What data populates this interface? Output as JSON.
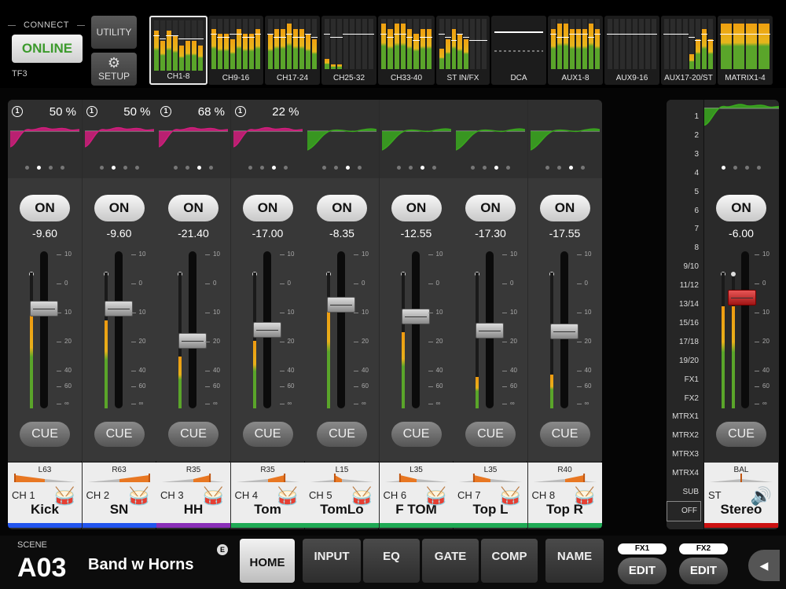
{
  "connect": {
    "title": "CONNECT",
    "status": "ONLINE",
    "device": "TF3"
  },
  "utility_label": "UTILITY",
  "setup_label": "SETUP",
  "banks": [
    {
      "label": "CH1-8",
      "selected": true
    },
    {
      "label": "CH9-16"
    },
    {
      "label": "CH17-24"
    },
    {
      "label": "CH25-32"
    },
    {
      "label": "CH33-40"
    },
    {
      "label": "ST IN/FX"
    },
    {
      "label": "DCA"
    },
    {
      "label": "AUX1-8"
    },
    {
      "label": "AUX9-16"
    },
    {
      "label": "AUX17-20/ST"
    },
    {
      "label": "MATRIX1-4"
    }
  ],
  "channels": [
    {
      "num": "1",
      "pct": "50 %",
      "on": "ON",
      "level": "-9.60",
      "cue": "CUE",
      "pan": "L63",
      "pan_value": -63,
      "id": "CH 1",
      "name": "Kick",
      "color": "#2255ee",
      "eq_color": "#d11d7d",
      "fader_db": -9.6,
      "meter": 0.69,
      "page": 1
    },
    {
      "num": "1",
      "pct": "50 %",
      "on": "ON",
      "level": "-9.60",
      "cue": "CUE",
      "pan": "R63",
      "pan_value": 63,
      "id": "CH 2",
      "name": "SN",
      "color": "#2255ee",
      "eq_color": "#d11d7d",
      "fader_db": -9.6,
      "meter": 0.65,
      "page": 1
    },
    {
      "num": "1",
      "pct": "68 %",
      "on": "ON",
      "level": "-21.40",
      "cue": "CUE",
      "pan": "R35",
      "pan_value": 35,
      "id": "CH 3",
      "name": "HH",
      "color": "#8a2fb8",
      "eq_color": "#d11d7d",
      "fader_db": -21.4,
      "meter": 0.38,
      "page": 2
    },
    {
      "num": "1",
      "pct": "22 %",
      "on": "ON",
      "level": "-17.00",
      "cue": "CUE",
      "pan": "R35",
      "pan_value": 35,
      "id": "CH 4",
      "name": "Tom",
      "color": "#1faa55",
      "eq_color": "#d11d7d",
      "fader_db": -17.0,
      "meter": 0.5,
      "page": 2
    },
    {
      "num": "",
      "pct": "",
      "on": "ON",
      "level": "-8.35",
      "cue": "CUE",
      "pan": "L15",
      "pan_value": -15,
      "id": "CH 5",
      "name": "TomLo",
      "color": "#1faa55",
      "eq_color": "#3aa81e",
      "fader_db": -8.35,
      "meter": 0.76,
      "page": 2
    },
    {
      "num": "",
      "pct": "",
      "on": "ON",
      "level": "-12.55",
      "cue": "CUE",
      "pan": "L35",
      "pan_value": -35,
      "id": "CH 6",
      "name": "F TOM",
      "color": "#1faa55",
      "eq_color": "#3aa81e",
      "fader_db": -12.55,
      "meter": 0.56,
      "page": 2
    },
    {
      "num": "",
      "pct": "",
      "on": "ON",
      "level": "-17.30",
      "cue": "CUE",
      "pan": "L35",
      "pan_value": -35,
      "id": "CH 7",
      "name": "Top L",
      "color": "#1faa55",
      "eq_color": "#3aa81e",
      "fader_db": -17.3,
      "meter": 0.23,
      "page": 2
    },
    {
      "num": "",
      "pct": "",
      "on": "ON",
      "level": "-17.55",
      "cue": "CUE",
      "pan": "R40",
      "pan_value": 40,
      "id": "CH 8",
      "name": "Top R",
      "color": "#1faa55",
      "eq_color": "#3aa81e",
      "fader_db": -17.55,
      "meter": 0.25,
      "page": 2
    }
  ],
  "scale_marks": [
    "10",
    "0",
    "10",
    "20",
    "40",
    "60",
    "∞"
  ],
  "dca_labels": [
    "1",
    "2",
    "3",
    "4",
    "5",
    "6",
    "7",
    "8",
    "9/10",
    "11/12",
    "13/14",
    "15/16",
    "17/18",
    "19/20",
    "FX1",
    "FX2",
    "MTRX1",
    "MTRX2",
    "MTRX3",
    "MTRX4",
    "SUB"
  ],
  "dca_off": "OFF",
  "stereo": {
    "on": "ON",
    "level": "-6.00",
    "cue": "CUE",
    "pan": "BAL",
    "pan_value": 0,
    "id": "ST",
    "name": "Stereo",
    "color": "#cc1111",
    "fader_db": -6.0,
    "meter": 0.75
  },
  "scene": {
    "label": "SCENE",
    "number": "A03",
    "name": "Band w Horns",
    "badge": "E"
  },
  "tabs": {
    "home": "HOME",
    "input": "INPUT",
    "eq": "EQ",
    "gate": "GATE",
    "comp": "COMP",
    "name": "NAME"
  },
  "fx": {
    "fx1": "FX1",
    "fx2": "FX2",
    "edit": "EDIT"
  },
  "icons": {
    "gear": "gear-icon",
    "arrow": "chevron-left-icon",
    "drum": "drum-icon",
    "speaker": "speaker-icon"
  }
}
